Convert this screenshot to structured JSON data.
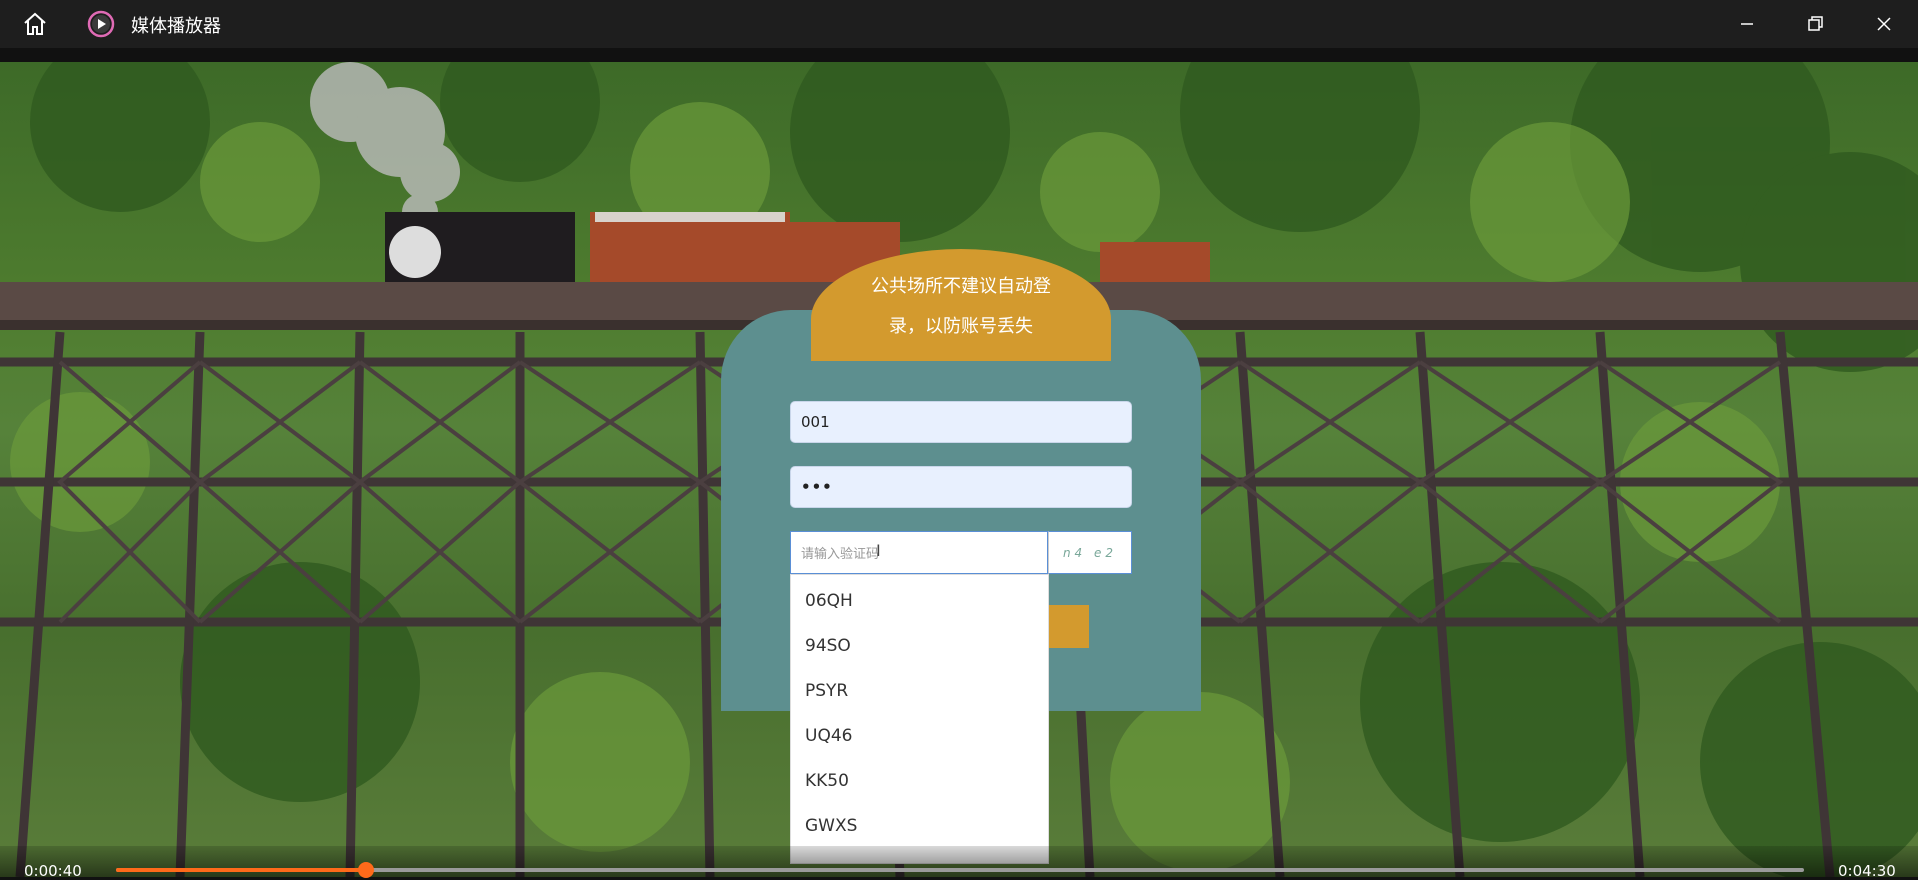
{
  "window": {
    "title": "媒体播放器",
    "icons": [
      "home-icon",
      "media-player-app-icon",
      "minimize-icon",
      "maximize-icon",
      "close-icon"
    ]
  },
  "login": {
    "notice": "公共场所不建议自动登录，以防账号丢失",
    "username_value": "001",
    "password_value": "•••",
    "captcha_placeholder": "请输入验证码",
    "captcha_image_text": "n4 e2",
    "autocomplete_options": [
      "06QH",
      "94SO",
      "PSYR",
      "UQ46",
      "KK50",
      "GWXS"
    ]
  },
  "player": {
    "current_time": "0:00:40",
    "total_time": "0:04:30",
    "progress_fraction": 0.148,
    "accent_color": "#ff6a1a"
  },
  "colors": {
    "card": "#5d8f8f",
    "banner": "#d39a2e",
    "titlebar": "#1e1e1e"
  }
}
